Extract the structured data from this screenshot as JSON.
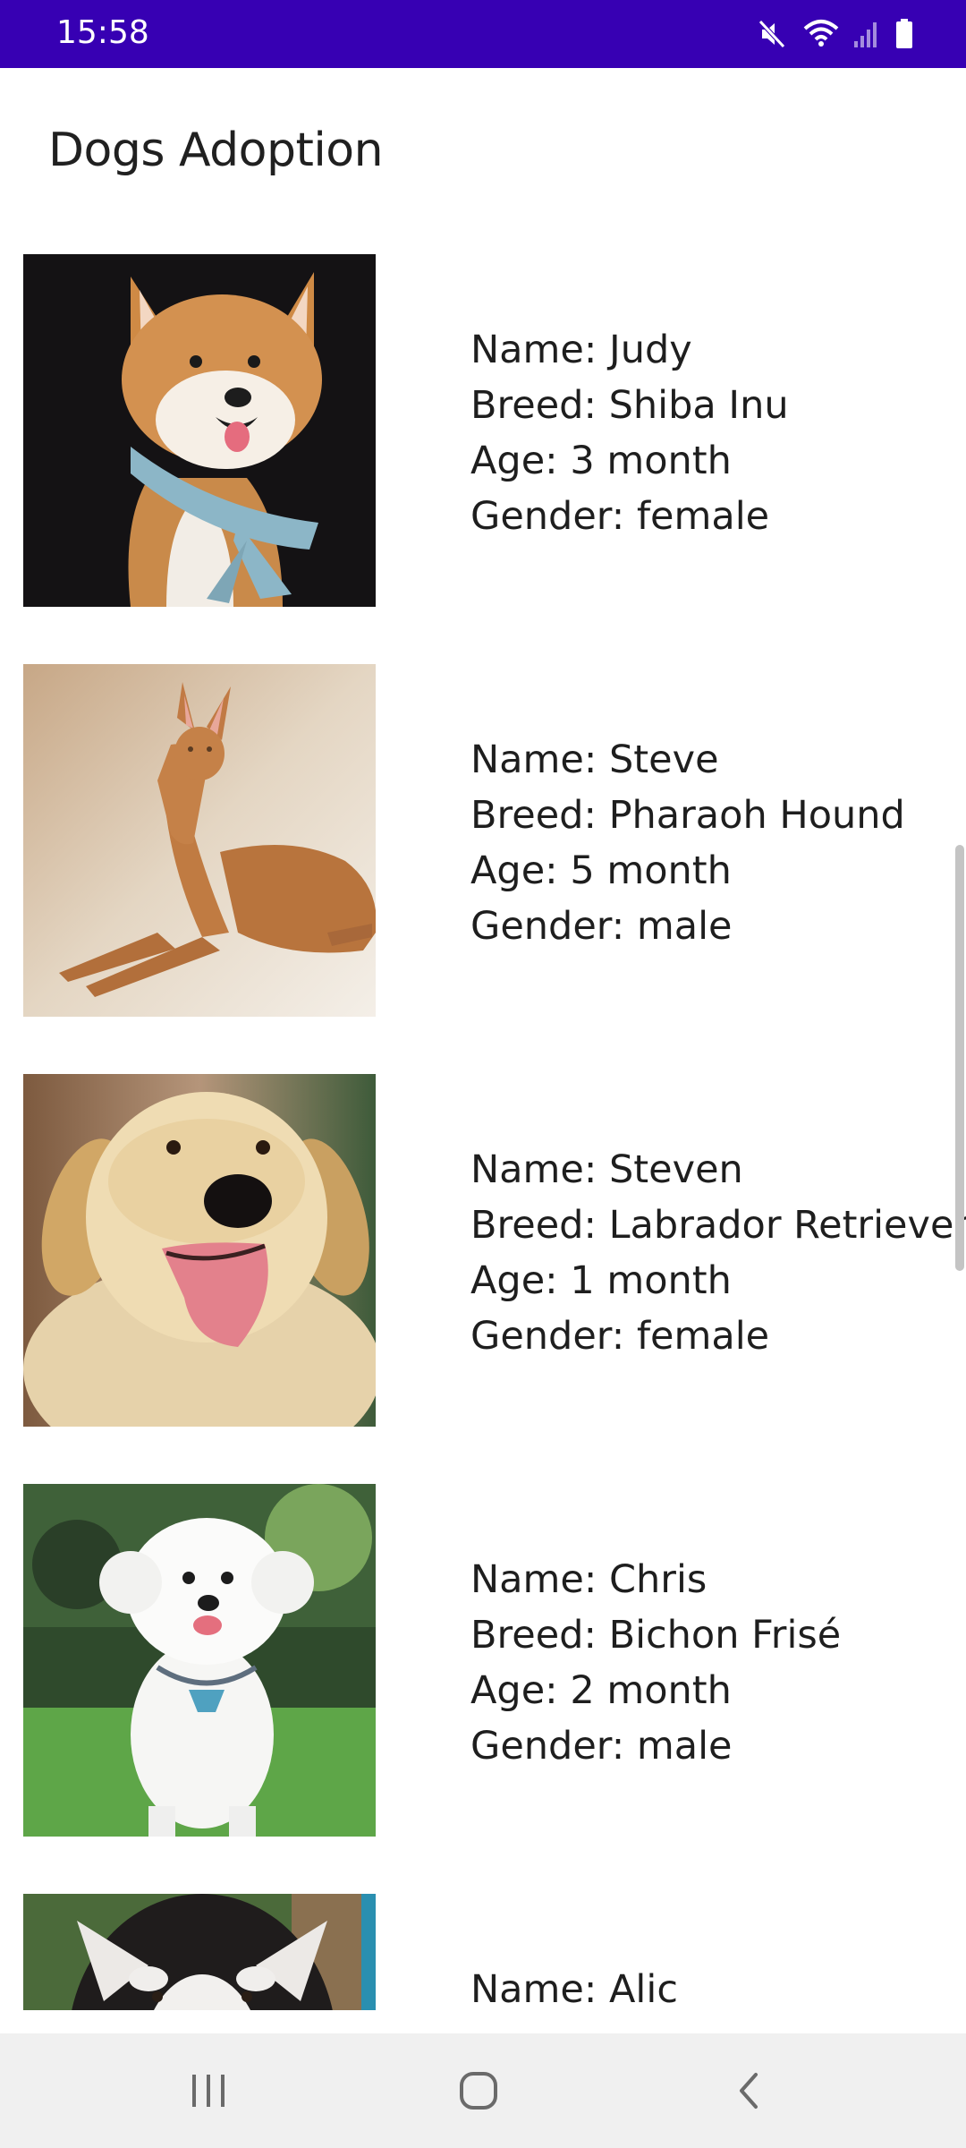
{
  "status_bar": {
    "time": "15:58",
    "icons": [
      "mute-icon",
      "wifi-icon",
      "signal-icon",
      "battery-icon"
    ],
    "background": "#3700B3"
  },
  "app": {
    "title": "Dogs Adoption"
  },
  "dogs": [
    {
      "name": "Name: Judy",
      "breed": "Breed: Shiba Inu",
      "age": "Age: 3 month",
      "gender": "Gender: female"
    },
    {
      "name": "Name: Steve",
      "breed": "Breed: Pharaoh Hound",
      "age": "Age: 5 month",
      "gender": "Gender: male"
    },
    {
      "name": "Name: Steven",
      "breed": "Breed: Labrador Retriever",
      "age": "Age: 1 month",
      "gender": "Gender: female"
    },
    {
      "name": "Name: Chris",
      "breed": "Breed: Bichon Frisé",
      "age": "Age: 2 month",
      "gender": "Gender: male"
    },
    {
      "name": "Name: Alic"
    }
  ],
  "nav_bar": {
    "buttons": [
      "recent-apps-icon",
      "home-icon",
      "back-icon"
    ]
  }
}
